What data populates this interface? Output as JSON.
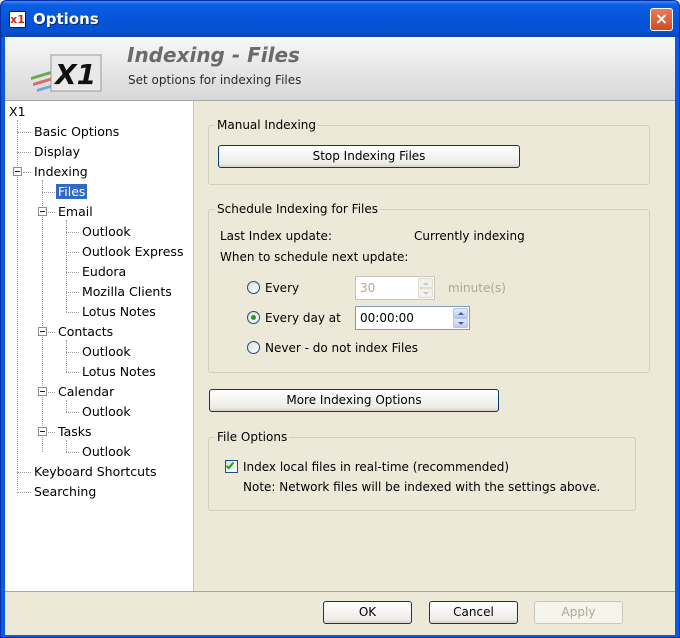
{
  "window": {
    "title": "Options",
    "app_icon_text": "x1",
    "close_glyph": "×"
  },
  "header": {
    "title": "Indexing - Files",
    "subtitle": "Set options for indexing Files",
    "logo": "X1"
  },
  "tree": {
    "root": "X1",
    "items": {
      "basic_options": "Basic Options",
      "display": "Display",
      "indexing": "Indexing",
      "files": "Files",
      "email": "Email",
      "email_outlook": "Outlook",
      "email_outlook_express": "Outlook Express",
      "email_eudora": "Eudora",
      "email_mozilla": "Mozilla Clients",
      "email_lotus": "Lotus Notes",
      "contacts": "Contacts",
      "contacts_outlook": "Outlook",
      "contacts_lotus": "Lotus Notes",
      "calendar": "Calendar",
      "calendar_outlook": "Outlook",
      "tasks": "Tasks",
      "tasks_outlook": "Outlook",
      "keyboard_shortcuts": "Keyboard Shortcuts",
      "searching": "Searching"
    },
    "selected": "Files"
  },
  "manual": {
    "legend": "Manual Indexing",
    "stop_button": "Stop Indexing Files"
  },
  "schedule": {
    "legend": "Schedule Indexing for Files",
    "last_update_label": "Last Index update:",
    "last_update_value": "Currently indexing",
    "when_label": "When to schedule next update:",
    "every_label": "Every",
    "every_value": "30",
    "every_unit": "minute(s)",
    "daily_label": "Every day at",
    "daily_value": "00:00:00",
    "never_label": "Never - do not index Files",
    "selected_option": "Every day at"
  },
  "more_button": "More Indexing Options",
  "file_options": {
    "legend": "File Options",
    "realtime_label": "Index local files in real-time (recommended)",
    "realtime_checked": true,
    "note": "Note: Network files will be indexed with the settings above."
  },
  "footer": {
    "ok": "OK",
    "cancel": "Cancel",
    "apply": "Apply"
  },
  "colors": {
    "titlebar": "#0553d8",
    "selection": "#316ac5",
    "panel": "#ece9d8",
    "radio_dot": "#21a121"
  }
}
